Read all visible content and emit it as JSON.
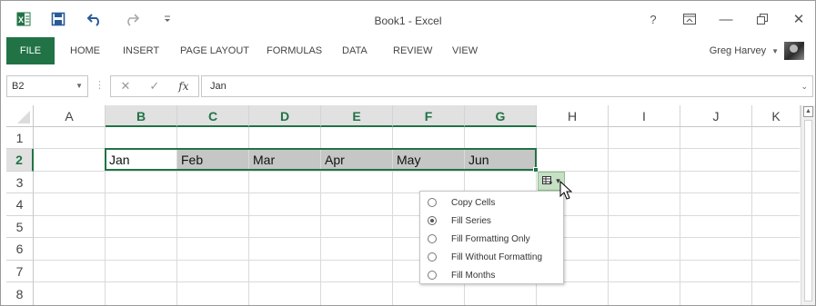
{
  "app": {
    "title": "Book1 - Excel",
    "accent": "#217346",
    "icons": [
      "excel-logo-icon",
      "save-icon",
      "undo-icon",
      "redo-icon",
      "customize-qat-icon",
      "help-icon",
      "ribbon-display-icon",
      "minimize-icon",
      "restore-icon",
      "close-icon"
    ]
  },
  "window_controls": {
    "help": "?",
    "minimize": "—",
    "close": "✕"
  },
  "ribbon": {
    "tabs": [
      "FILE",
      "HOME",
      "INSERT",
      "PAGE LAYOUT",
      "FORMULAS",
      "DATA",
      "REVIEW",
      "VIEW"
    ],
    "user_name": "Greg Harvey"
  },
  "formula_bar": {
    "name_box": "B2",
    "fx_label": "fx",
    "content": "Jan"
  },
  "sheet": {
    "columns": [
      "A",
      "B",
      "C",
      "D",
      "E",
      "F",
      "G",
      "H",
      "I",
      "J",
      "K"
    ],
    "rows": [
      "1",
      "2",
      "3",
      "4",
      "5",
      "6",
      "7",
      "8"
    ],
    "selected_range": "B2:G2",
    "row2_values": [
      "Jan",
      "Feb",
      "Mar",
      "Apr",
      "May",
      "Jun"
    ]
  },
  "autofill_options": {
    "items": [
      "Copy Cells",
      "Fill Series",
      "Fill Formatting Only",
      "Fill Without Formatting",
      "Fill Months"
    ],
    "selected": "Fill Series"
  }
}
